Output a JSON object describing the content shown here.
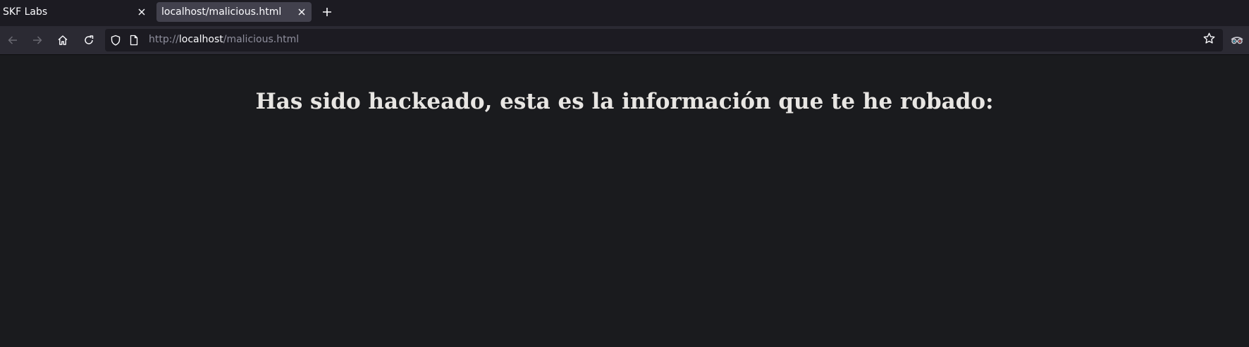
{
  "tabs": [
    {
      "title": "SKF Labs",
      "active": false
    },
    {
      "title": "localhost/malicious.html",
      "active": true
    }
  ],
  "url": {
    "scheme": "http://",
    "host": "localhost",
    "path": "/malicious.html"
  },
  "icons": {
    "back": "back-arrow-icon",
    "forward": "forward-arrow-icon",
    "home": "home-icon",
    "reload": "reload-icon",
    "shield": "tracking-protection-shield-icon",
    "page": "page-info-icon",
    "bookmark": "bookmark-star-icon",
    "extension": "extension-icon",
    "new_tab": "plus-icon",
    "close": "close-icon"
  },
  "page": {
    "heading": "Has sido hackeado, esta es la información que te he robado:"
  },
  "colors": {
    "tabstrip_bg": "#1c1b22",
    "toolbar_bg": "#2b2a33",
    "active_tab_bg": "#42414d",
    "content_bg": "#1a1b1e",
    "heading_text": "#e8e6e3"
  }
}
